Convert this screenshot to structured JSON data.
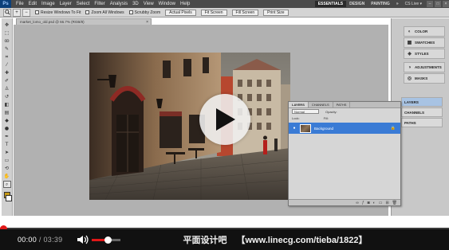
{
  "app": {
    "logo": "Ps",
    "menu": [
      "File",
      "Edit",
      "Image",
      "Layer",
      "Select",
      "Filter",
      "Analysis",
      "3D",
      "View",
      "Window",
      "Help"
    ],
    "workspaces": [
      "ESSENTIALS",
      "DESIGN",
      "PAINTING"
    ],
    "workspace_more": "»",
    "cs_live": "CS Live ▾",
    "window_controls": [
      "–",
      "□",
      "×"
    ]
  },
  "options_bar": {
    "resize_windows_label": "Resize Windows To Fit",
    "zoom_all_windows_label": "Zoom All Windows",
    "scrubby_zoom_label": "Scrubby Zoom",
    "buttons": [
      "Actual Pixels",
      "Fit Screen",
      "Fill Screen",
      "Print Size"
    ]
  },
  "document": {
    "tab_title": "market_lomo_old.psd @ 66.7% (RGB/8)",
    "tab_close": "×"
  },
  "right_panels": {
    "group1": [
      "COLOR",
      "SWATCHES",
      "STYLES"
    ],
    "group2": [
      "ADJUSTMENTS",
      "MASKS"
    ],
    "group3": [
      "LAYERS",
      "CHANNELS",
      "PATHS"
    ],
    "active": "LAYERS"
  },
  "layers_panel": {
    "tabs": [
      "LAYERS",
      "CHANNELS",
      "PATHS"
    ],
    "blend_mode": "Normal",
    "opacity_label": "Opacity:",
    "lock_label": "Lock:",
    "fill_label": "Fill:",
    "layer_name": "Background",
    "eye": "●",
    "lock_icon": "🔒"
  },
  "video": {
    "current_time": "00:00",
    "duration": "03:39",
    "volume_level": 0.55,
    "watermark_cn": "平面设计吧",
    "watermark_url": "【www.linecg.com/tieba/1822】",
    "colors": {
      "bar_bg": "#111111",
      "accent": "#e01818"
    }
  }
}
